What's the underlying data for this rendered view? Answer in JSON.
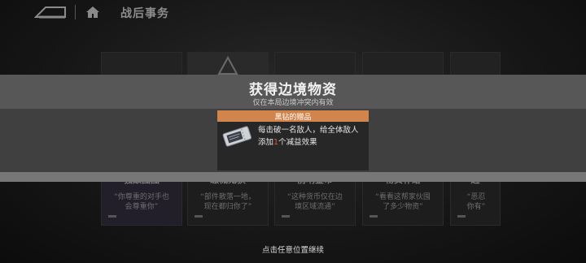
{
  "topbar": {
    "title": "战后事务",
    "back_icon": "back-arrow-icon",
    "home_icon": "home-icon"
  },
  "cards": [
    {
      "title": "强敌图图",
      "quote_1": "“你尊重的对手也",
      "quote_2": "会尊重你”"
    },
    {
      "title": "缴械鬼获",
      "quote_1": "“部件散落一地，",
      "quote_2": "现在都归你了”"
    },
    {
      "title": "前哨金币",
      "quote_1": "“这种货币仅在边",
      "quote_2": "境区域流通”"
    },
    {
      "title": "物资补给",
      "quote_1": "“看看这帮家伙囤",
      "quote_2": "了多少物资”"
    },
    {
      "title": "边",
      "quote_1": "“恶忍",
      "quote_2": "你有”"
    }
  ],
  "modal": {
    "title": "获得边境物资",
    "subtitle": "仅在本局边境冲突内有效",
    "item": {
      "name": "黑钻的赠品",
      "icon": "ticket-icon",
      "desc_part1": "每击破一名敌人，给全体敌人添",
      "desc_part2": "加",
      "desc_highlight": "1",
      "desc_part3": "个减益效果"
    }
  },
  "footer": {
    "continue_label": "点击任意位置继续"
  },
  "colors": {
    "accent_orange": "#d1844b",
    "highlight_red": "#e5523a"
  }
}
